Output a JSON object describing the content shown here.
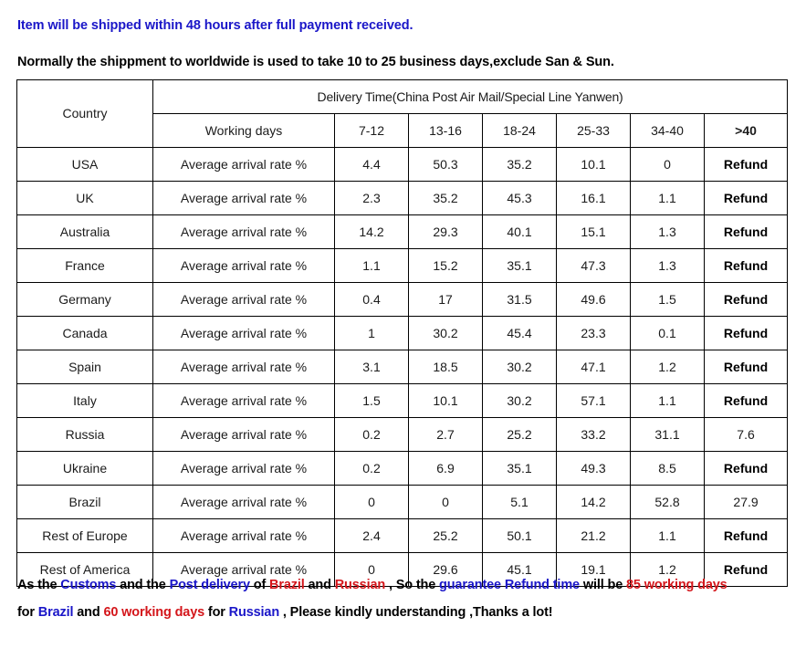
{
  "notices": {
    "shipping_time": "Item will be shipped within 48 hours after full payment received.",
    "worldwide_note": "Normally the shippment to worldwide is used to take 10 to 25 business days,exclude San & Sun."
  },
  "table": {
    "country_header": "Country",
    "delivery_header": "Delivery Time(China Post Air Mail/Special Line Yanwen)",
    "working_days_header": "Working days",
    "day_ranges": [
      "7-12",
      "13-16",
      "18-24",
      "25-33",
      "34-40",
      ">40"
    ],
    "rate_label": "Average arrival rate %",
    "rows": [
      {
        "country": "USA",
        "rate_label": "Average arrival rate %",
        "values": [
          "4.4",
          "50.3",
          "35.2",
          "10.1",
          "0",
          "Refund"
        ]
      },
      {
        "country": "UK",
        "rate_label": "Average arrival rate %",
        "values": [
          "2.3",
          "35.2",
          "45.3",
          "16.1",
          "1.1",
          "Refund"
        ]
      },
      {
        "country": "Australia",
        "rate_label": "Average arrival rate %",
        "values": [
          "14.2",
          "29.3",
          "40.1",
          "15.1",
          "1.3",
          "Refund"
        ]
      },
      {
        "country": "France",
        "rate_label": "Average arrival rate %",
        "values": [
          "1.1",
          "15.2",
          "35.1",
          "47.3",
          "1.3",
          "Refund"
        ]
      },
      {
        "country": "Germany",
        "rate_label": "Average arrival rate %",
        "values": [
          "0.4",
          "17",
          "31.5",
          "49.6",
          "1.5",
          "Refund"
        ]
      },
      {
        "country": "Canada",
        "rate_label": "Average arrival rate %",
        "values": [
          "1",
          "30.2",
          "45.4",
          "23.3",
          "0.1",
          "Refund"
        ]
      },
      {
        "country": "Spain",
        "rate_label": "Average arrival rate %",
        "values": [
          "3.1",
          "18.5",
          "30.2",
          "47.1",
          "1.2",
          "Refund"
        ]
      },
      {
        "country": "Italy",
        "rate_label": "Average arrival rate %",
        "values": [
          "1.5",
          "10.1",
          "30.2",
          "57.1",
          "1.1",
          "Refund"
        ]
      },
      {
        "country": "Russia",
        "rate_label": "Average arrival rate %",
        "values": [
          "0.2",
          "2.7",
          "25.2",
          "33.2",
          "31.1",
          "7.6"
        ]
      },
      {
        "country": "Ukraine",
        "rate_label": "Average arrival rate %",
        "values": [
          "0.2",
          "6.9",
          "35.1",
          "49.3",
          "8.5",
          "Refund"
        ]
      },
      {
        "country": "Brazil",
        "rate_label": "Average arrival rate %",
        "values": [
          "0",
          "0",
          "5.1",
          "14.2",
          "52.8",
          "27.9"
        ]
      },
      {
        "country": "Rest of Europe",
        "rate_label": "Average arrival rate %",
        "values": [
          "2.4",
          "25.2",
          "50.1",
          "21.2",
          "1.1",
          "Refund"
        ]
      },
      {
        "country": "Rest of America",
        "rate_label": "Average arrival rate %",
        "values": [
          "0",
          "29.6",
          "45.1",
          "19.1",
          "1.2",
          "Refund"
        ]
      }
    ]
  },
  "footer": {
    "line1": [
      {
        "text": "As the ",
        "color": "black"
      },
      {
        "text": "Customs ",
        "color": "blue"
      },
      {
        "text": "and the ",
        "color": "black"
      },
      {
        "text": "Post delivery ",
        "color": "blue"
      },
      {
        "text": "of ",
        "color": "black"
      },
      {
        "text": "Brazil ",
        "color": "red"
      },
      {
        "text": "and ",
        "color": "black"
      },
      {
        "text": "Russian ",
        "color": "red"
      },
      {
        "text": ", So the ",
        "color": "black"
      },
      {
        "text": "guarantee Refund time ",
        "color": "blue"
      },
      {
        "text": "will be ",
        "color": "black"
      },
      {
        "text": "85 working days",
        "color": "red"
      }
    ],
    "line2": [
      {
        "text": "for ",
        "color": "black"
      },
      {
        "text": "Brazil ",
        "color": "blue"
      },
      {
        "text": "and ",
        "color": "black"
      },
      {
        "text": "60 working days ",
        "color": "red"
      },
      {
        "text": "for ",
        "color": "black"
      },
      {
        "text": "Russian",
        "color": "blue"
      },
      {
        "text": " , Please kindly understanding ,Thanks a lot!",
        "color": "black"
      }
    ]
  },
  "colors": {
    "blue": "#1a16c8",
    "red": "#d4161b",
    "black": "#000000",
    "border": "#000000",
    "background": "#ffffff"
  }
}
